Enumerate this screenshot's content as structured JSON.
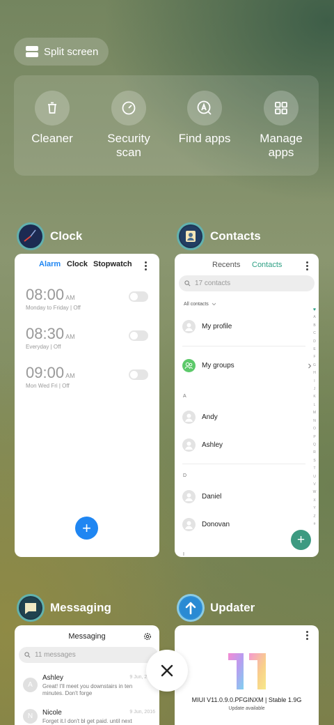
{
  "split_screen": {
    "label": "Split screen",
    "icon": "split-screen-icon"
  },
  "quick_actions": [
    {
      "label": "Cleaner",
      "icon": "trash-icon"
    },
    {
      "label": "Security\nscan",
      "icon": "shield-scan-icon"
    },
    {
      "label": "Find apps",
      "icon": "find-apps-icon"
    },
    {
      "label": "Manage\napps",
      "icon": "grid-icon"
    }
  ],
  "clock": {
    "app_name": "Clock",
    "tabs": [
      "Alarm",
      "Clock",
      "Stopwatch"
    ],
    "alarms": [
      {
        "time": "08:00",
        "ampm": "AM",
        "days": "Monday to Friday",
        "status": "Off"
      },
      {
        "time": "08:30",
        "ampm": "AM",
        "days": "Everyday",
        "status": "Off"
      },
      {
        "time": "09:00",
        "ampm": "AM",
        "days": "Mon Wed Fri",
        "status": "Off"
      }
    ],
    "add_label": "+"
  },
  "contacts": {
    "app_name": "Contacts",
    "tabs": [
      "Recents",
      "Contacts"
    ],
    "search_placeholder": "17 contacts",
    "filter_label": "All contacts",
    "my_profile": "My profile",
    "my_groups": "My groups",
    "sections": [
      {
        "letter": "A",
        "names": [
          "Andy",
          "Ashley"
        ]
      },
      {
        "letter": "D",
        "names": [
          "Daniel",
          "Donovan"
        ]
      }
    ],
    "index_letters": [
      "♥",
      "A",
      "B",
      "C",
      "D",
      "E",
      "F",
      "G",
      "H",
      "I",
      "J",
      "K",
      "L",
      "M",
      "N",
      "O",
      "P",
      "Q",
      "R",
      "S",
      "T",
      "U",
      "V",
      "W",
      "X",
      "Y",
      "Z",
      "#"
    ],
    "next_section_letter": "I",
    "add_label": "+"
  },
  "messaging": {
    "app_name": "Messaging",
    "header_title": "Messaging",
    "search_placeholder": "11 messages",
    "messages": [
      {
        "initial": "A",
        "name": "Ashley",
        "date": "9 Jun, 2016",
        "text": "Great! I'll meet you downstairs in ten minutes. Don't forge"
      },
      {
        "initial": "N",
        "name": "Nicole",
        "date": "9 Jun, 2016",
        "text": "Forget it.I don't bl get paid. until next Friday."
      }
    ]
  },
  "updater": {
    "app_name": "Updater",
    "version": "MIUI V11.0.9.0.PFGINXM | Stable 1.9G",
    "status": "Update available"
  },
  "close_label": "×",
  "colors": {
    "accent_blue": "#1f86f2",
    "contacts_green": "#3d9a81",
    "tab_teal": "#2c9f83",
    "groups_green": "#5cc96a"
  }
}
